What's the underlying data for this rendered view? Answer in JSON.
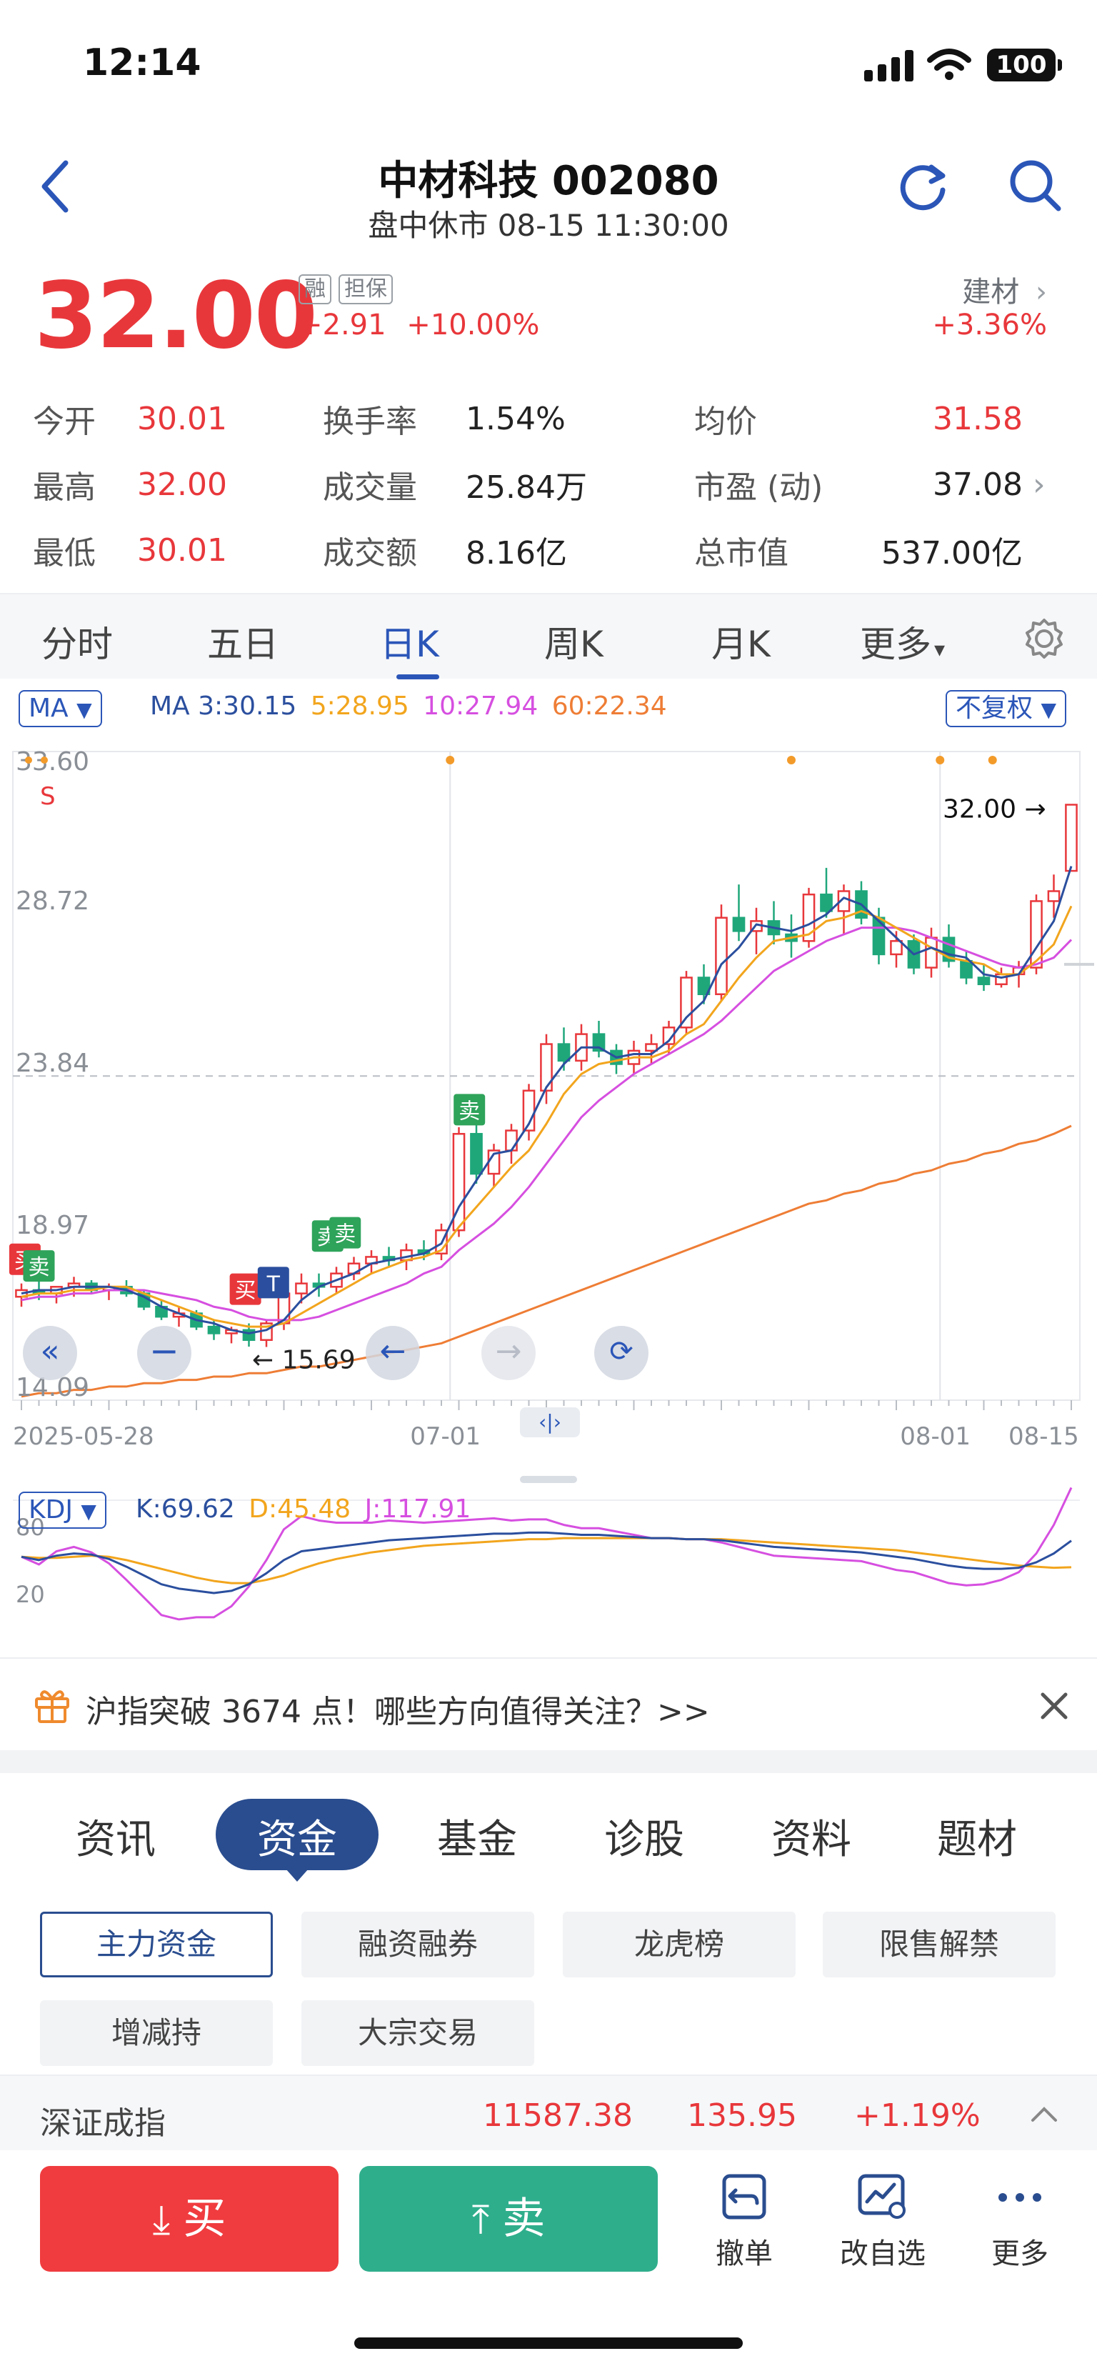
{
  "status": {
    "time": "12:14",
    "battery": "100"
  },
  "header": {
    "title": "中材科技 002080",
    "subtitle": "盘中休市 08-15 11:30:00"
  },
  "quote": {
    "price": "32.00",
    "tag1": "融",
    "tag2": "担保",
    "change": "+2.91",
    "change_pct": "+10.00%",
    "sector": "建材",
    "sector_change": "+3.36%"
  },
  "stats": {
    "open_label": "今开",
    "open": "30.01",
    "high_label": "最高",
    "high": "32.00",
    "low_label": "最低",
    "low": "30.01",
    "turnover_label": "换手率",
    "turnover": "1.54%",
    "volume_label": "成交量",
    "volume": "25.84万",
    "amount_label": "成交额",
    "amount": "8.16亿",
    "avg_label": "均价",
    "avg": "31.58",
    "pe_label": "市盈 (动)",
    "pe": "37.08",
    "mcap_label": "总市值",
    "mcap": "537.00亿"
  },
  "chart_tabs": [
    "分时",
    "五日",
    "日K",
    "周K",
    "月K",
    "更多"
  ],
  "ma": {
    "selector": "MA",
    "ma3": "MA 3:30.15",
    "ma5": "5:28.95",
    "ma10": "10:27.94",
    "ma60": "60:22.34",
    "adjust": "不复权"
  },
  "chart_data": {
    "type": "candlestick",
    "title": "",
    "y_ticks": [
      "33.60",
      "28.72",
      "23.84",
      "18.97",
      "14.09"
    ],
    "ylim": [
      14.09,
      33.6
    ],
    "x_ticks": [
      "2025-05-28",
      "07-01",
      "08-01",
      "08-15"
    ],
    "last_price_label": "32.00",
    "low_marker_label": "15.69",
    "signal_labels": {
      "sell": "卖",
      "buy": "买",
      "t": "T",
      "s": "S"
    },
    "series": [
      {
        "name": "K",
        "candles": [
          [
            17.2,
            17.6,
            16.9,
            17.4
          ],
          [
            17.4,
            17.7,
            17.1,
            17.3
          ],
          [
            17.3,
            17.5,
            17.0,
            17.5
          ],
          [
            17.5,
            17.8,
            17.2,
            17.6
          ],
          [
            17.6,
            17.7,
            17.3,
            17.4
          ],
          [
            17.4,
            17.6,
            17.1,
            17.5
          ],
          [
            17.5,
            17.7,
            17.2,
            17.3
          ],
          [
            17.3,
            17.4,
            16.8,
            16.9
          ],
          [
            16.9,
            17.1,
            16.5,
            16.6
          ],
          [
            16.6,
            16.9,
            16.3,
            16.7
          ],
          [
            16.7,
            16.8,
            16.2,
            16.3
          ],
          [
            16.3,
            16.5,
            15.9,
            16.1
          ],
          [
            16.1,
            16.3,
            15.8,
            16.2
          ],
          [
            16.2,
            16.4,
            15.7,
            15.9
          ],
          [
            15.9,
            16.5,
            15.69,
            16.4
          ],
          [
            16.4,
            17.5,
            16.2,
            17.3
          ],
          [
            17.3,
            17.9,
            17.0,
            17.6
          ],
          [
            17.6,
            17.9,
            17.2,
            17.5
          ],
          [
            17.5,
            18.1,
            17.3,
            17.9
          ],
          [
            17.9,
            18.4,
            17.7,
            18.2
          ],
          [
            18.2,
            18.6,
            17.9,
            18.4
          ],
          [
            18.4,
            18.7,
            18.1,
            18.3
          ],
          [
            18.3,
            18.8,
            18.0,
            18.6
          ],
          [
            18.6,
            18.9,
            18.3,
            18.5
          ],
          [
            18.5,
            19.4,
            18.3,
            19.2
          ],
          [
            19.2,
            22.3,
            19.0,
            22.1
          ],
          [
            22.1,
            22.4,
            20.6,
            20.9
          ],
          [
            20.9,
            21.8,
            20.5,
            21.6
          ],
          [
            21.6,
            22.4,
            21.2,
            22.2
          ],
          [
            22.2,
            23.6,
            21.9,
            23.4
          ],
          [
            23.4,
            25.1,
            23.0,
            24.8
          ],
          [
            24.8,
            25.3,
            24.0,
            24.3
          ],
          [
            24.3,
            25.4,
            24.0,
            25.1
          ],
          [
            25.1,
            25.5,
            24.4,
            24.6
          ],
          [
            24.6,
            24.8,
            23.9,
            24.2
          ],
          [
            24.2,
            24.9,
            23.9,
            24.6
          ],
          [
            24.6,
            25.1,
            24.2,
            24.8
          ],
          [
            24.8,
            25.5,
            24.5,
            25.3
          ],
          [
            25.3,
            27.0,
            25.1,
            26.8
          ],
          [
            26.8,
            27.2,
            26.0,
            26.3
          ],
          [
            26.3,
            29.0,
            26.1,
            28.6
          ],
          [
            28.6,
            29.6,
            27.9,
            28.2
          ],
          [
            28.2,
            28.9,
            27.5,
            28.5
          ],
          [
            28.5,
            29.1,
            27.8,
            28.1
          ],
          [
            28.1,
            28.7,
            27.4,
            27.9
          ],
          [
            27.9,
            29.5,
            27.7,
            29.3
          ],
          [
            29.3,
            30.1,
            28.6,
            28.8
          ],
          [
            28.8,
            29.6,
            28.1,
            29.4
          ],
          [
            29.4,
            29.7,
            28.4,
            28.6
          ],
          [
            28.6,
            28.9,
            27.2,
            27.5
          ],
          [
            27.5,
            28.2,
            27.1,
            27.9
          ],
          [
            27.9,
            28.1,
            26.9,
            27.1
          ],
          [
            27.1,
            28.3,
            26.8,
            28.0
          ],
          [
            28.0,
            28.4,
            27.1,
            27.3
          ],
          [
            27.3,
            27.6,
            26.6,
            26.8
          ],
          [
            26.8,
            27.2,
            26.4,
            26.6
          ],
          [
            26.6,
            27.1,
            26.5,
            26.9
          ],
          [
            26.9,
            27.3,
            26.5,
            27.1
          ],
          [
            27.1,
            29.3,
            26.9,
            29.1
          ],
          [
            29.1,
            29.9,
            28.6,
            29.4
          ],
          [
            30.01,
            32.0,
            30.01,
            32.0
          ]
        ]
      },
      {
        "name": "MA3",
        "values": [
          17.3,
          17.4,
          17.4,
          17.5,
          17.5,
          17.5,
          17.4,
          17.2,
          16.9,
          16.7,
          16.5,
          16.4,
          16.2,
          16.1,
          16.2,
          16.5,
          17.1,
          17.5,
          17.7,
          17.9,
          18.2,
          18.3,
          18.4,
          18.5,
          18.8,
          19.9,
          20.7,
          21.5,
          21.6,
          22.4,
          23.5,
          24.2,
          24.7,
          24.7,
          24.4,
          24.5,
          24.5,
          24.9,
          25.6,
          26.1,
          27.2,
          27.7,
          28.4,
          28.3,
          28.2,
          28.4,
          28.7,
          29.2,
          29.0,
          28.5,
          28.0,
          27.5,
          27.7,
          27.5,
          27.4,
          26.9,
          26.8,
          26.9,
          27.7,
          28.5,
          30.15
        ]
      },
      {
        "name": "MA5",
        "values": [
          17.2,
          17.3,
          17.3,
          17.4,
          17.4,
          17.5,
          17.5,
          17.3,
          17.1,
          16.9,
          16.7,
          16.5,
          16.4,
          16.3,
          16.3,
          16.4,
          16.7,
          17.0,
          17.3,
          17.6,
          17.9,
          18.1,
          18.3,
          18.4,
          18.6,
          19.3,
          19.9,
          20.5,
          21.1,
          21.6,
          22.4,
          23.3,
          23.9,
          24.2,
          24.3,
          24.4,
          24.4,
          24.6,
          25.1,
          25.4,
          26.1,
          26.8,
          27.4,
          27.9,
          28.0,
          28.1,
          28.5,
          28.6,
          28.8,
          28.6,
          28.3,
          28.0,
          27.7,
          27.4,
          27.3,
          27.2,
          26.9,
          26.9,
          27.3,
          27.8,
          28.95
        ]
      },
      {
        "name": "MA10",
        "values": [
          17.1,
          17.2,
          17.2,
          17.3,
          17.3,
          17.4,
          17.4,
          17.4,
          17.3,
          17.2,
          17.1,
          16.9,
          16.8,
          16.6,
          16.5,
          16.5,
          16.5,
          16.6,
          16.8,
          17.0,
          17.2,
          17.4,
          17.6,
          17.9,
          18.1,
          18.6,
          19.0,
          19.4,
          19.9,
          20.5,
          21.2,
          21.9,
          22.6,
          23.1,
          23.5,
          23.9,
          24.2,
          24.5,
          24.8,
          25.1,
          25.5,
          26.0,
          26.5,
          27.0,
          27.3,
          27.6,
          27.9,
          28.1,
          28.3,
          28.3,
          28.3,
          28.2,
          28.0,
          27.8,
          27.6,
          27.4,
          27.2,
          27.1,
          27.2,
          27.4,
          27.94
        ]
      },
      {
        "name": "MA60",
        "values": [
          14.2,
          14.3,
          14.3,
          14.4,
          14.4,
          14.5,
          14.5,
          14.6,
          14.6,
          14.7,
          14.7,
          14.8,
          14.8,
          14.9,
          14.9,
          15.0,
          15.1,
          15.1,
          15.2,
          15.3,
          15.4,
          15.5,
          15.6,
          15.7,
          15.8,
          16.0,
          16.2,
          16.4,
          16.6,
          16.8,
          17.0,
          17.2,
          17.4,
          17.6,
          17.8,
          18.0,
          18.2,
          18.4,
          18.6,
          18.8,
          19.0,
          19.2,
          19.4,
          19.6,
          19.8,
          20.0,
          20.1,
          20.3,
          20.4,
          20.6,
          20.7,
          20.9,
          21.0,
          21.2,
          21.3,
          21.5,
          21.6,
          21.8,
          21.9,
          22.1,
          22.34
        ]
      }
    ],
    "kdj": {
      "selector": "KDJ",
      "k_label": "K:69.62",
      "d_label": "D:45.48",
      "j_label": "J:117.91",
      "y_ticks": [
        "80",
        "20"
      ],
      "K": [
        55,
        52,
        56,
        58,
        57,
        53,
        46,
        38,
        30,
        26,
        24,
        22,
        24,
        30,
        40,
        52,
        60,
        62,
        64,
        66,
        68,
        70,
        71,
        72,
        73,
        74,
        75,
        76,
        76,
        77,
        77,
        76,
        75,
        75,
        74,
        73,
        72,
        72,
        71,
        71,
        70,
        68,
        66,
        64,
        63,
        62,
        61,
        60,
        59,
        57,
        55,
        53,
        50,
        47,
        45,
        44,
        44,
        45,
        50,
        58,
        69.62
      ],
      "D": [
        55,
        54,
        54,
        55,
        56,
        55,
        52,
        48,
        44,
        40,
        36,
        33,
        31,
        31,
        34,
        38,
        44,
        49,
        53,
        56,
        59,
        61,
        63,
        65,
        66,
        67,
        68,
        69,
        70,
        71,
        71,
        72,
        72,
        72,
        72,
        72,
        72,
        72,
        71,
        71,
        71,
        70,
        69,
        68,
        67,
        66,
        65,
        64,
        63,
        62,
        61,
        59,
        57,
        55,
        53,
        51,
        49,
        47,
        46,
        45,
        45.48
      ],
      "J": [
        55,
        48,
        60,
        64,
        59,
        49,
        34,
        18,
        2,
        -2,
        0,
        0,
        10,
        28,
        52,
        80,
        92,
        88,
        86,
        86,
        86,
        88,
        87,
        86,
        87,
        88,
        89,
        90,
        88,
        89,
        89,
        84,
        81,
        81,
        78,
        75,
        72,
        72,
        71,
        71,
        68,
        64,
        60,
        56,
        55,
        54,
        53,
        52,
        51,
        47,
        43,
        41,
        36,
        31,
        29,
        30,
        34,
        41,
        58,
        84,
        117.91
      ]
    }
  },
  "banner": {
    "text": "沪指突破 3674 点！哪些方向值得关注？>>"
  },
  "info_tabs": [
    "资讯",
    "资金",
    "基金",
    "诊股",
    "资料",
    "题材"
  ],
  "chips": [
    "主力资金",
    "融资融券",
    "龙虎榜",
    "限售解禁",
    "增减持",
    "大宗交易"
  ],
  "index": {
    "name": "深证成指",
    "value": "11587.38",
    "change": "135.95",
    "change_pct": "+1.19%"
  },
  "bottom": {
    "buy": "买",
    "sell": "卖",
    "cancel": "撤单",
    "watch": "改自选",
    "more": "更多"
  },
  "colors": {
    "up": "#e8373b",
    "down": "#1fa77a",
    "accent": "#2b56b8",
    "ma3": "#2b4f9e",
    "ma5": "#f2a51d",
    "ma10": "#d64fe0",
    "ma60": "#ee7d35"
  }
}
